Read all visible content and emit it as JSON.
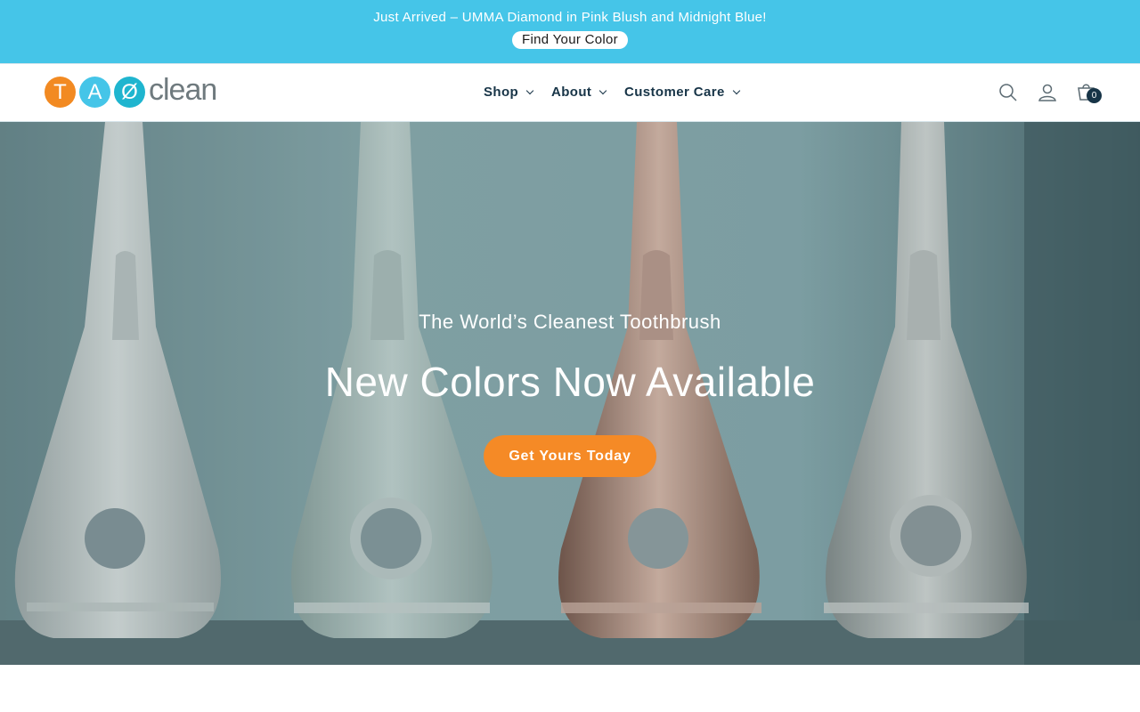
{
  "announcement": {
    "text": "Just Arrived – UMMA Diamond in Pink Blush and Midnight Blue!",
    "button_label": "Find Your Color"
  },
  "header": {
    "logo": {
      "letters": [
        "T",
        "A",
        "Ø"
      ],
      "word": "clean"
    },
    "nav": [
      {
        "label": "Shop",
        "icon": "chevron-down-icon"
      },
      {
        "label": "About",
        "icon": "chevron-down-icon"
      },
      {
        "label": "Customer Care",
        "icon": "chevron-down-icon"
      }
    ],
    "icons": [
      "search-icon",
      "account-icon",
      "cart-icon"
    ],
    "cart_count": "0"
  },
  "hero": {
    "subtitle": "The World’s Cleanest Toothbrush",
    "title": "New Colors Now Available",
    "cta_label": "Get Yours Today"
  },
  "colors": {
    "announcement_bg": "#45c5e8",
    "nav_text": "#173447",
    "cta_bg": "#f58a26",
    "logo_orange": "#f28a22",
    "logo_blue": "#45c5e8",
    "logo_teal": "#1fb5cf"
  }
}
